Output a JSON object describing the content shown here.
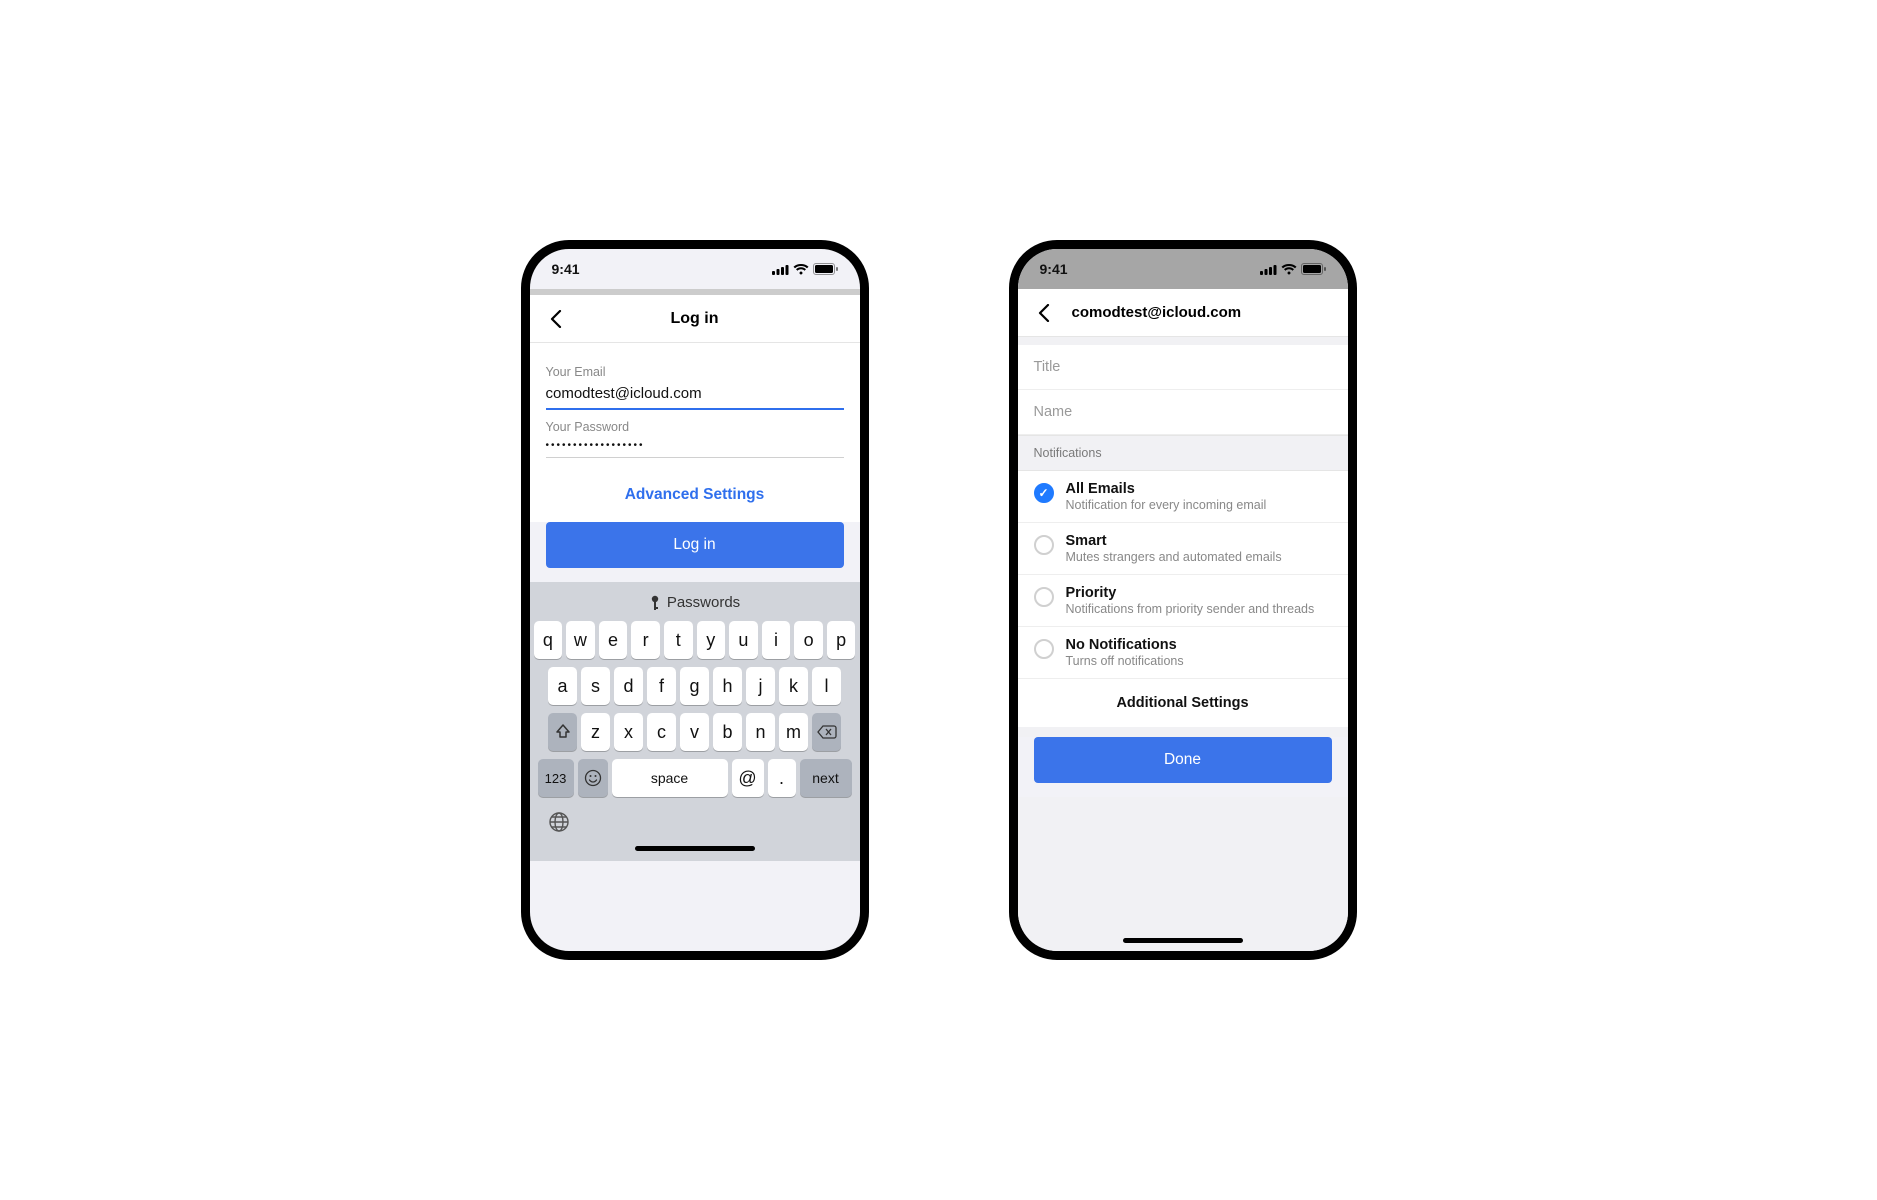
{
  "statusbar": {
    "time": "9:41"
  },
  "login": {
    "title": "Log in",
    "email_label": "Your Email",
    "email_value": "comodtest@icloud.com",
    "password_label": "Your Password",
    "password_value": "••••••••••••••••••",
    "advanced": "Advanced Settings",
    "button": "Log in"
  },
  "keyboard": {
    "suggestion": "Passwords",
    "row1": [
      "q",
      "w",
      "e",
      "r",
      "t",
      "y",
      "u",
      "i",
      "o",
      "p"
    ],
    "row2": [
      "a",
      "s",
      "d",
      "f",
      "g",
      "h",
      "j",
      "k",
      "l"
    ],
    "row3": [
      "z",
      "x",
      "c",
      "v",
      "b",
      "n",
      "m"
    ],
    "numkey": "123",
    "space": "space",
    "at": "@",
    "dot": ".",
    "next": "next"
  },
  "notif": {
    "title": "comodtest@icloud.com",
    "input_title_placeholder": "Title",
    "input_name_placeholder": "Name",
    "section": "Notifications",
    "options": [
      {
        "t": "All Emails",
        "s": "Notification for every incoming email",
        "checked": true
      },
      {
        "t": "Smart",
        "s": "Mutes strangers and automated emails",
        "checked": false
      },
      {
        "t": "Priority",
        "s": "Notifications from priority sender and threads",
        "checked": false
      },
      {
        "t": "No Notifications",
        "s": "Turns off notifications",
        "checked": false
      }
    ],
    "additional": "Additional Settings",
    "done": "Done"
  }
}
